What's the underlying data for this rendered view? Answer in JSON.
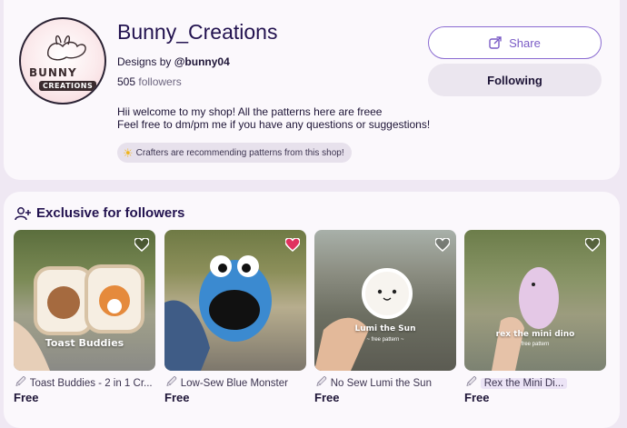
{
  "shop": {
    "logo_text_1": "BUNNY",
    "logo_text_2": "CREATIONS",
    "title": "Bunny_Creations",
    "designs_by_prefix": "Designs by ",
    "designs_by_handle": "@bunny04",
    "followers_count": "505",
    "followers_label": " followers",
    "bio_line_1": "Hii welcome to my shop! All the patterns here are freee",
    "bio_line_2": "Feel free to dm/pm me if you have any questions or suggestions!",
    "recommend_badge": "Crafters are recommending patterns from this shop!",
    "share_label": "Share",
    "following_label": "Following"
  },
  "exclusive": {
    "title": "Exclusive for followers",
    "products": [
      {
        "name": "Toast Buddies - 2 in 1 Cr...",
        "price": "Free",
        "caption": "Toast Buddies",
        "subcaption": "",
        "liked": false
      },
      {
        "name": "Low-Sew Blue Monster",
        "price": "Free",
        "caption": "",
        "subcaption": "",
        "liked": true
      },
      {
        "name": "No Sew Lumi the Sun",
        "price": "Free",
        "caption": "Lumi the Sun",
        "subcaption": "~ free pattern ~",
        "liked": false
      },
      {
        "name": "Rex the Mini Di...",
        "price": "Free",
        "caption": "rex the mini dino",
        "subcaption": "free pattern",
        "liked": false
      }
    ]
  },
  "colors": {
    "accent": "#7b5cc6",
    "heart_liked": "#e0325f",
    "title": "#22124f"
  }
}
